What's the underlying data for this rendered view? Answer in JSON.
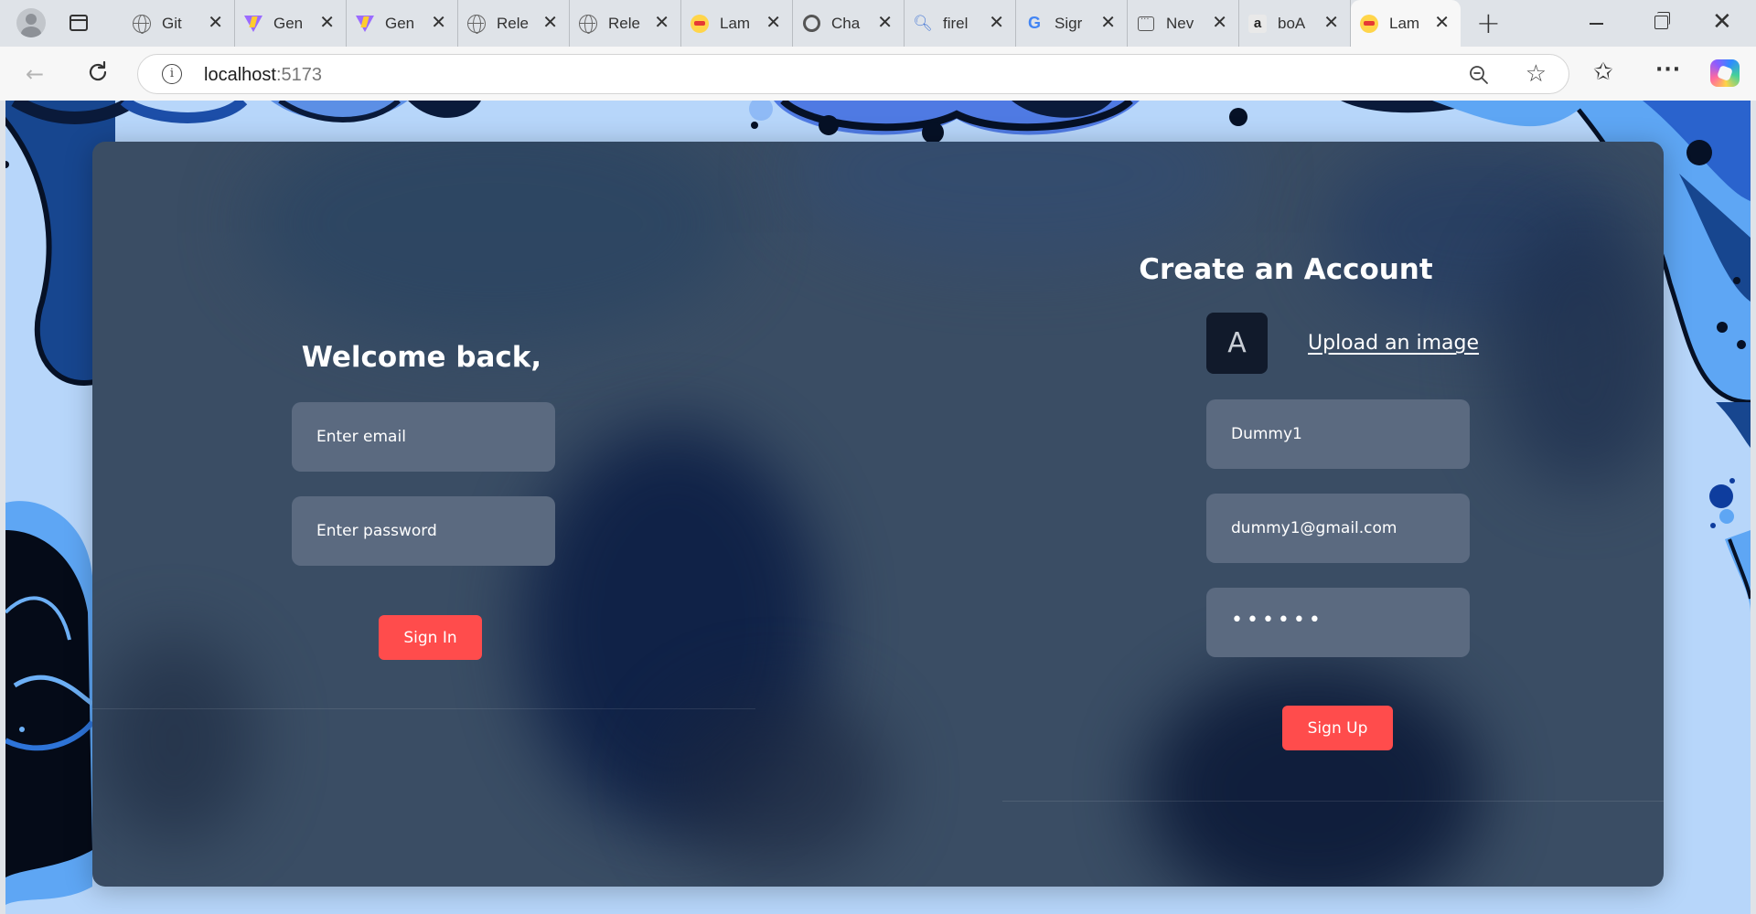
{
  "browser": {
    "tabs": [
      {
        "title": "Git",
        "icon": "globe-icon"
      },
      {
        "title": "Gen",
        "icon": "vite-icon"
      },
      {
        "title": "Gen",
        "icon": "vite-icon"
      },
      {
        "title": "Rele",
        "icon": "globe-icon"
      },
      {
        "title": "Rele",
        "icon": "globe-icon"
      },
      {
        "title": "Lam",
        "icon": "lam-icon"
      },
      {
        "title": "Cha",
        "icon": "openai-icon"
      },
      {
        "title": "firel",
        "icon": "search-icon"
      },
      {
        "title": "Sigr",
        "icon": "google-icon"
      },
      {
        "title": "Nev",
        "icon": "newtab-icon"
      },
      {
        "title": "boA",
        "icon": "amazon-icon"
      },
      {
        "title": "Lam",
        "icon": "lam-icon",
        "active": true
      }
    ],
    "address": {
      "host": "localhost",
      "port": ":5173"
    }
  },
  "login": {
    "title": "Welcome back,",
    "email_placeholder": "Enter email",
    "password_placeholder": "Enter password",
    "submit_label": "Sign In"
  },
  "register": {
    "title": "Create an Account",
    "avatar_letter": "A",
    "upload_label": "Upload an image",
    "username_value": "Dummy1",
    "email_value": "dummy1@gmail.com",
    "password_value": "••••••",
    "submit_label": "Sign Up"
  },
  "colors": {
    "accent": "#ff4c4c",
    "card": "#3a4d64",
    "input": "#5b6a80",
    "page_background": "#b7d6fa"
  }
}
